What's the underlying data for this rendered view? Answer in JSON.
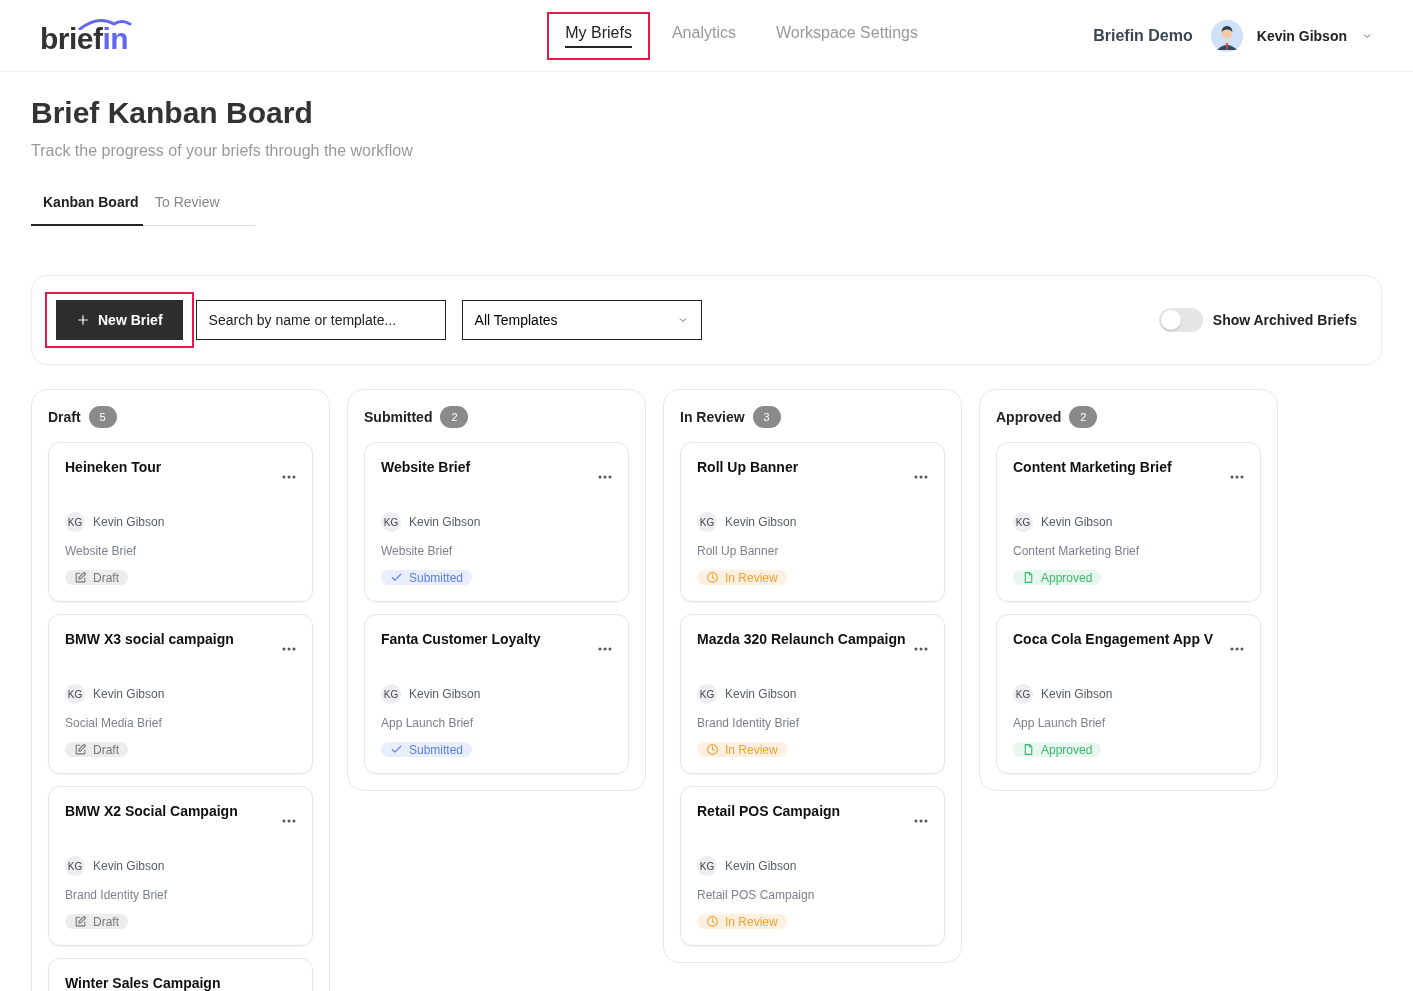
{
  "header": {
    "logo": {
      "dark": "brief",
      "accent": "in"
    },
    "nav": [
      {
        "label": "My Briefs",
        "selected": true,
        "highlighted": true
      },
      {
        "label": "Analytics",
        "selected": false,
        "highlighted": false
      },
      {
        "label": "Workspace Settings",
        "selected": false,
        "highlighted": false
      }
    ],
    "workspace": "Briefin Demo",
    "user": "Kevin Gibson"
  },
  "page": {
    "title": "Brief Kanban Board",
    "subtitle": "Track the progress of your briefs through the workflow"
  },
  "tabs": [
    {
      "label": "Kanban Board",
      "selected": true
    },
    {
      "label": "To Review",
      "selected": false
    }
  ],
  "toolbar": {
    "new_button": {
      "label": "New Brief",
      "highlighted": true
    },
    "search": {
      "placeholder": "Search by name or template..."
    },
    "template_select": {
      "value": "All Templates"
    },
    "archived_toggle": {
      "label": "Show Archived Briefs",
      "on": false
    }
  },
  "columns": [
    {
      "name": "Draft",
      "count": "5",
      "cards": [
        {
          "title": "Heineken Tour",
          "owner_initials": "KG",
          "owner": "Kevin Gibson",
          "template": "Website Brief",
          "status": {
            "kind": "draft",
            "label": "Draft"
          }
        },
        {
          "title": "BMW X3 social campaign",
          "owner_initials": "KG",
          "owner": "Kevin Gibson",
          "template": "Social Media Brief",
          "status": {
            "kind": "draft",
            "label": "Draft"
          }
        },
        {
          "title": "BMW X2 Social Campaign",
          "owner_initials": "KG",
          "owner": "Kevin Gibson",
          "template": "Brand Identity Brief",
          "status": {
            "kind": "draft",
            "label": "Draft"
          }
        },
        {
          "title": "Winter Sales Campaign"
        }
      ]
    },
    {
      "name": "Submitted",
      "count": "2",
      "cards": [
        {
          "title": "Website Brief",
          "owner_initials": "KG",
          "owner": "Kevin Gibson",
          "template": "Website Brief",
          "status": {
            "kind": "submitted",
            "label": "Submitted"
          }
        },
        {
          "title": "Fanta Customer Loyalty",
          "owner_initials": "KG",
          "owner": "Kevin Gibson",
          "template": "App Launch Brief",
          "status": {
            "kind": "submitted",
            "label": "Submitted"
          }
        }
      ]
    },
    {
      "name": "In Review",
      "count": "3",
      "cards": [
        {
          "title": "Roll Up Banner",
          "owner_initials": "KG",
          "owner": "Kevin Gibson",
          "template": "Roll Up Banner",
          "status": {
            "kind": "in_review",
            "label": "In Review"
          }
        },
        {
          "title": "Mazda 320 Relaunch Campaign",
          "owner_initials": "KG",
          "owner": "Kevin Gibson",
          "template": "Brand Identity Brief",
          "status": {
            "kind": "in_review",
            "label": "In Review"
          }
        },
        {
          "title": "Retail POS Campaign",
          "owner_initials": "KG",
          "owner": "Kevin Gibson",
          "template": "Retail POS Campaign",
          "status": {
            "kind": "in_review",
            "label": "In Review"
          }
        }
      ]
    },
    {
      "name": "Approved",
      "count": "2",
      "cards": [
        {
          "title": "Content Marketing Brief",
          "owner_initials": "KG",
          "owner": "Kevin Gibson",
          "template": "Content Marketing Brief",
          "status": {
            "kind": "approved",
            "label": "Approved"
          }
        },
        {
          "title": "Coca Cola Engagement App V",
          "owner_initials": "KG",
          "owner": "Kevin Gibson",
          "template": "App Launch Brief",
          "status": {
            "kind": "approved",
            "label": "Approved"
          }
        }
      ]
    }
  ]
}
